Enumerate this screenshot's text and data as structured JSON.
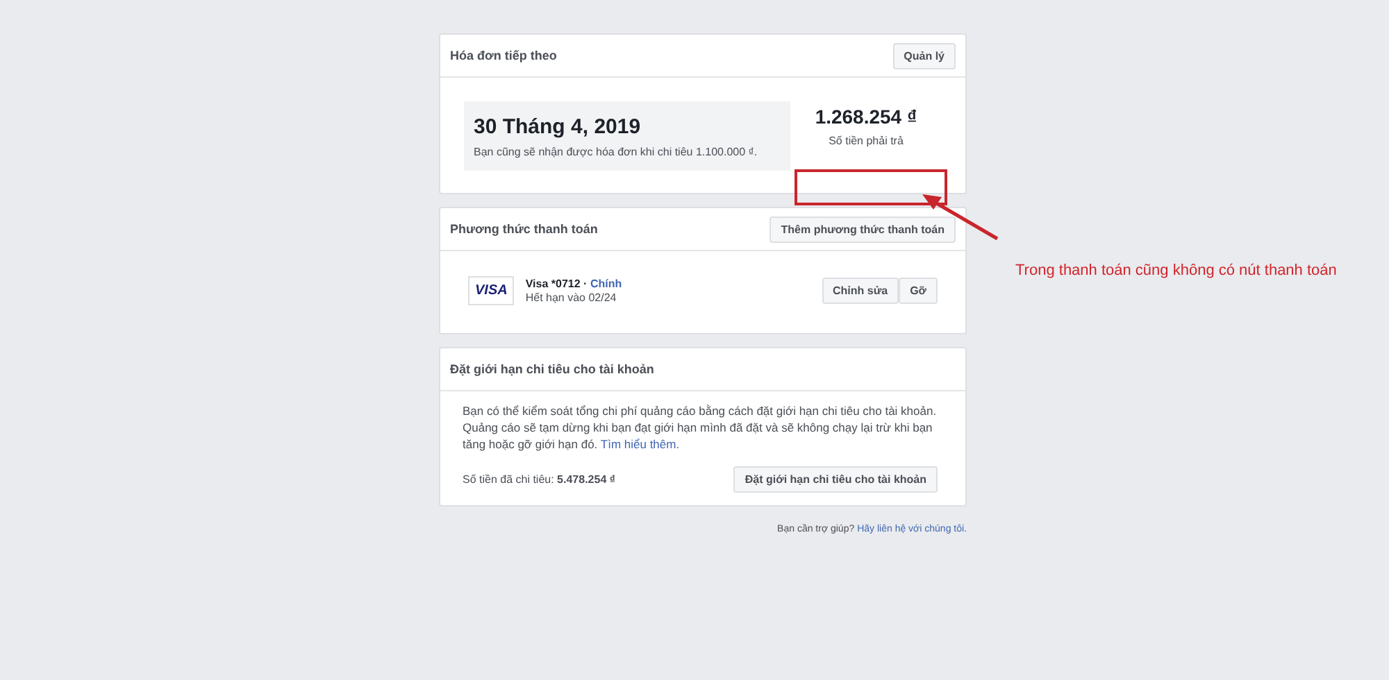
{
  "next_bill": {
    "title": "Hóa đơn tiếp theo",
    "manage_button": "Quản lý",
    "date": "30 Tháng 4, 2019",
    "note": "Bạn cũng sẽ nhận được hóa đơn khi chi tiêu 1.100.000 ₫.",
    "amount": "1.268.254 ₫",
    "amount_label": "Số tiền phải trả"
  },
  "payment_methods": {
    "title": "Phương thức thanh toán",
    "add_button": "Thêm phương thức thanh toán",
    "cards": [
      {
        "brand": "VISA",
        "name": "Visa *0712",
        "separator": "·",
        "primary_label": "Chính",
        "expiry": "Hết hạn vào 02/24",
        "buttons": [
          "Chỉnh sửa",
          "Gỡ"
        ]
      }
    ]
  },
  "spending_limit": {
    "title": "Đặt giới hạn chi tiêu cho tài khoản",
    "description": "Bạn có thể kiểm soát tổng chi phí quảng cáo bằng cách đặt giới hạn chi tiêu cho tài khoản. Quảng cáo sẽ tạm dừng khi bạn đạt giới hạn mình đã đặt và sẽ không chạy lại trừ khi bạn tăng hoặc gỡ giới hạn đó.",
    "learn_more": "Tìm hiểu thêm.",
    "spent": "Số tiền đã chi tiêu: **5.478.254 ₫**",
    "button": "Đặt giới hạn chi tiêu cho tài khoản"
  },
  "help": {
    "question": "Bạn cần trợ giúp?",
    "link": "Hãy liên hệ với chúng tôi."
  },
  "annotation": {
    "text": "Trong thanh toán cũng không có nút thanh toán"
  }
}
